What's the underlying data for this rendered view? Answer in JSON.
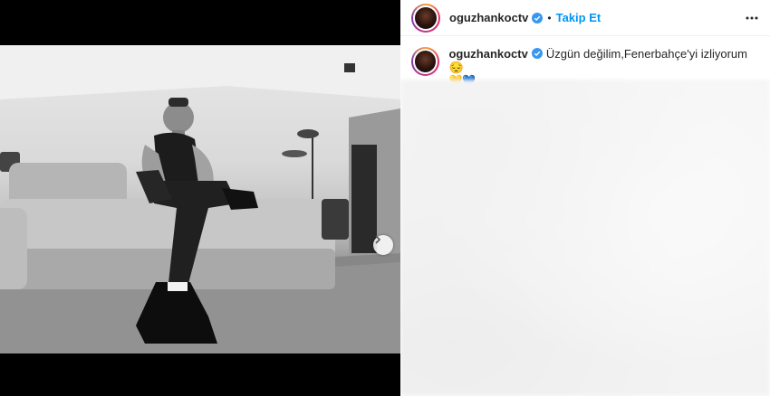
{
  "post": {
    "username": "oguzhankoctv",
    "follow_label": "Takip Et",
    "separator": "•",
    "caption": "Üzgün değilim,Fenerbahçe'yi izliyorum 😔",
    "caption_emojis": "💛💙"
  },
  "icons": {
    "verified": "verified-badge-icon",
    "more": "more-options-icon",
    "next": "chevron-right-icon"
  },
  "colors": {
    "follow": "#0095f6",
    "verified": "#3897f0"
  }
}
